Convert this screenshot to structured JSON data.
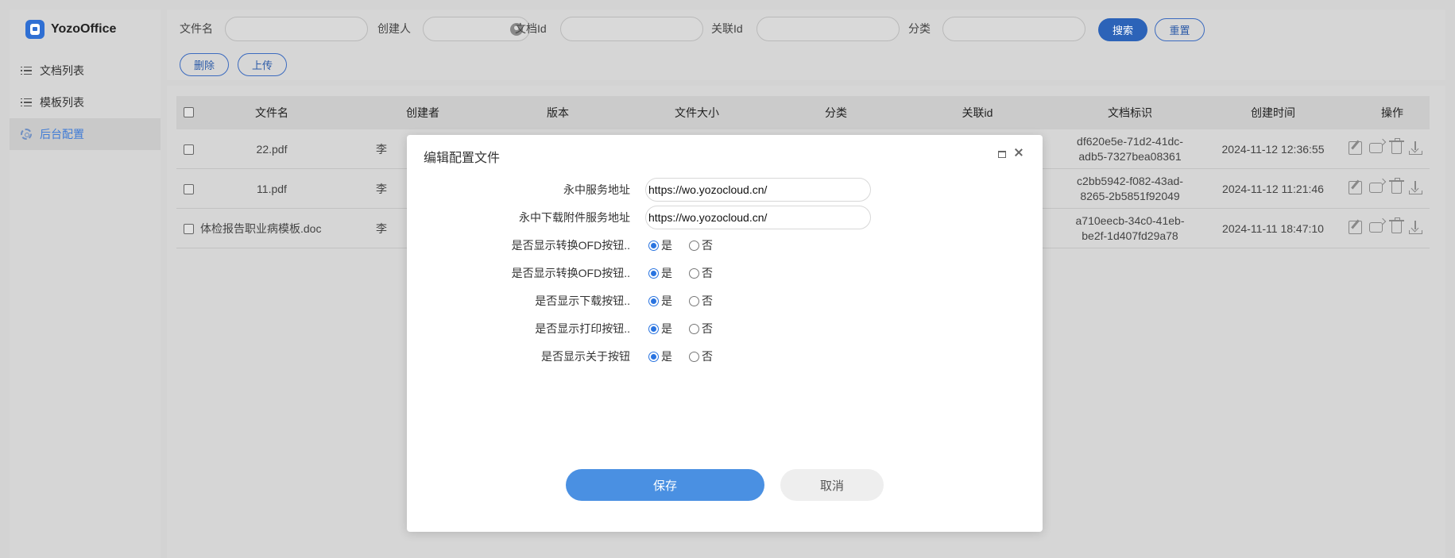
{
  "app": {
    "name": "YozoOffice"
  },
  "sidebar": {
    "items": [
      {
        "label": "文档列表",
        "icon": "list-icon",
        "active": false
      },
      {
        "label": "模板列表",
        "icon": "list-icon",
        "active": false
      },
      {
        "label": "后台配置",
        "icon": "gear-icon",
        "active": true
      }
    ]
  },
  "search": {
    "filename_label": "文件名",
    "filename_value": "",
    "creator_label": "创建人",
    "creator_value": "",
    "doc_id_label": "文档Id",
    "doc_id_value": "",
    "related_id_label": "关联Id",
    "related_id_value": "",
    "category_label": "分类",
    "category_value": "",
    "search_button": "搜索",
    "reset_button": "重置",
    "delete_button": "删除",
    "upload_button": "上传"
  },
  "table": {
    "headers": [
      "文件名",
      "创建者",
      "版本",
      "文件大小",
      "分类",
      "关联id",
      "文档标识",
      "创建时间",
      "操作"
    ],
    "rows": [
      {
        "filename": "22.pdf",
        "creator": "李",
        "doc_id_line1": "df620e5e-71d2-41dc-",
        "doc_id_line2": "adb5-7327bea08361",
        "created": "2024-11-12 12:36:55"
      },
      {
        "filename": "11.pdf",
        "creator": "李",
        "doc_id_line1": "c2bb5942-f082-43ad-",
        "doc_id_line2": "8265-2b5851f92049",
        "created": "2024-11-12 11:21:46"
      },
      {
        "filename": "体检报告职业病模板.doc",
        "creator": "李",
        "doc_id_line1": "a710eecb-34c0-41eb-",
        "doc_id_line2": "be2f-1d407fd29a78",
        "created": "2024-11-11 18:47:10"
      }
    ],
    "row_actions": [
      "edit-icon",
      "replace-icon",
      "trash-icon",
      "download-icon"
    ]
  },
  "modal": {
    "title": "编辑配置文件",
    "fields": [
      {
        "label": "永中服务地址",
        "type": "text",
        "value": "https://wo.yozocloud.cn/"
      },
      {
        "label": "永中下载附件服务地址",
        "type": "text",
        "value": "https://wo.yozocloud.cn/"
      },
      {
        "label": "是否显示转换OFD按钮..",
        "type": "radio",
        "yes": "是",
        "no": "否",
        "selected": "是"
      },
      {
        "label": "是否显示转换OFD按钮..",
        "type": "radio",
        "yes": "是",
        "no": "否",
        "selected": "是"
      },
      {
        "label": "是否显示下载按钮..",
        "type": "radio",
        "yes": "是",
        "no": "否",
        "selected": "是"
      },
      {
        "label": "是否显示打印按钮..",
        "type": "radio",
        "yes": "是",
        "no": "否",
        "selected": "是"
      },
      {
        "label": "是否显示关于按钮",
        "type": "radio",
        "yes": "是",
        "no": "否",
        "selected": "是"
      }
    ],
    "save_button": "保存",
    "cancel_button": "取消"
  },
  "colors": {
    "primary": "#4a90e2",
    "overlay": "#d3d3d3",
    "radio_checked": "#2a74e0"
  }
}
